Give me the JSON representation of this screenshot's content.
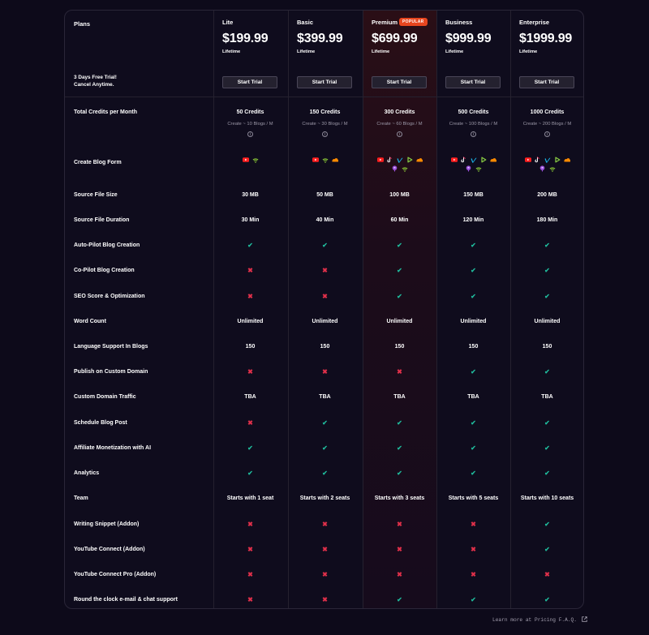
{
  "plans_label": "Plans",
  "trial_note": [
    "3 Days Free Trial!",
    "Cancel Anytime."
  ],
  "colors": {
    "check": "#1fb89a",
    "cross": "#e0304a",
    "badge": "#e8461f"
  },
  "plans": [
    {
      "name": "Lite",
      "price": "$199.99",
      "period": "Lifetime",
      "button": "Start Trial",
      "badge": null
    },
    {
      "name": "Basic",
      "price": "$399.99",
      "period": "Lifetime",
      "button": "Start Trial",
      "badge": null
    },
    {
      "name": "Premium",
      "price": "$699.99",
      "period": "Lifetime",
      "button": "Start Trial",
      "badge": "POPULAR"
    },
    {
      "name": "Business",
      "price": "$999.99",
      "period": "Lifetime",
      "button": "Start Trial",
      "badge": null
    },
    {
      "name": "Enterprise",
      "price": "$1999.99",
      "period": "Lifetime",
      "button": "Start Trial",
      "badge": null
    }
  ],
  "rows": [
    {
      "label": "Total Credits per Month",
      "type": "credits",
      "values": [
        {
          "main": "50 Credits",
          "sub": "Create ~ 10 Blogs / M"
        },
        {
          "main": "150 Credits",
          "sub": "Create ~ 30 Blogs / M"
        },
        {
          "main": "300 Credits",
          "sub": "Create ~ 60 Blogs / M"
        },
        {
          "main": "500 Credits",
          "sub": "Create ~ 100 Blogs / M"
        },
        {
          "main": "1000 Credits",
          "sub": "Create ~ 200 Blogs / M"
        }
      ]
    },
    {
      "label": "Create Blog Form",
      "type": "icons",
      "values": [
        [
          "youtube-icon",
          "rss-icon"
        ],
        [
          "youtube-icon",
          "rss-icon",
          "soundcloud-icon"
        ],
        [
          "youtube-icon",
          "tiktok-icon",
          "vimeo-icon",
          "rumble-icon",
          "soundcloud-icon",
          "podcast-icon",
          "rss-icon"
        ],
        [
          "youtube-icon",
          "tiktok-icon",
          "vimeo-icon",
          "rumble-icon",
          "soundcloud-icon",
          "podcast-icon",
          "rss-icon"
        ],
        [
          "youtube-icon",
          "tiktok-icon",
          "vimeo-icon",
          "rumble-icon",
          "soundcloud-icon",
          "podcast-icon",
          "rss-icon"
        ]
      ]
    },
    {
      "label": "Source File Size",
      "type": "text",
      "values": [
        "30 MB",
        "50 MB",
        "100 MB",
        "150 MB",
        "200 MB"
      ]
    },
    {
      "label": "Source File Duration",
      "type": "text",
      "values": [
        "30 Min",
        "40 Min",
        "60 Min",
        "120 Min",
        "180 Min"
      ]
    },
    {
      "label": "Auto-Pilot Blog Creation",
      "type": "bool",
      "values": [
        true,
        true,
        true,
        true,
        true
      ]
    },
    {
      "label": "Co-Pilot Blog Creation",
      "type": "bool",
      "values": [
        false,
        false,
        true,
        true,
        true
      ]
    },
    {
      "label": "SEO Score & Optimization",
      "type": "bool",
      "values": [
        false,
        false,
        true,
        true,
        true
      ]
    },
    {
      "label": "Word Count",
      "type": "text",
      "values": [
        "Unlimited",
        "Unlimited",
        "Unlimited",
        "Unlimited",
        "Unlimited"
      ]
    },
    {
      "label": "Language Support In Blogs",
      "type": "text",
      "values": [
        "150",
        "150",
        "150",
        "150",
        "150"
      ]
    },
    {
      "label": "Publish on Custom Domain",
      "type": "bool",
      "values": [
        false,
        false,
        false,
        true,
        true
      ]
    },
    {
      "label": "Custom Domain Traffic",
      "type": "text",
      "values": [
        "TBA",
        "TBA",
        "TBA",
        "TBA",
        "TBA"
      ]
    },
    {
      "label": "Schedule Blog Post",
      "type": "bool",
      "values": [
        false,
        true,
        true,
        true,
        true
      ]
    },
    {
      "label": "Affiliate Monetization with AI",
      "type": "bool",
      "values": [
        true,
        true,
        true,
        true,
        true
      ]
    },
    {
      "label": "Analytics",
      "type": "bool",
      "values": [
        true,
        true,
        true,
        true,
        true
      ]
    },
    {
      "label": "Team",
      "type": "text",
      "values": [
        "Starts with 1 seat",
        "Starts with 2 seats",
        "Starts with 3 seats",
        "Starts with 5 seats",
        "Starts with 10 seats"
      ]
    },
    {
      "label": "Writing Snippet (Addon)",
      "type": "bool",
      "values": [
        false,
        false,
        false,
        false,
        true
      ]
    },
    {
      "label": "YouTube Connect (Addon)",
      "type": "bool",
      "values": [
        false,
        false,
        false,
        false,
        true
      ]
    },
    {
      "label": "YouTube Connect Pro (Addon)",
      "type": "bool",
      "values": [
        false,
        false,
        false,
        false,
        false
      ]
    },
    {
      "label": "Round the clock e-mail & chat support",
      "type": "bool",
      "values": [
        false,
        false,
        true,
        true,
        true
      ]
    }
  ],
  "footer_link": "Learn more at Pricing F.A.Q."
}
